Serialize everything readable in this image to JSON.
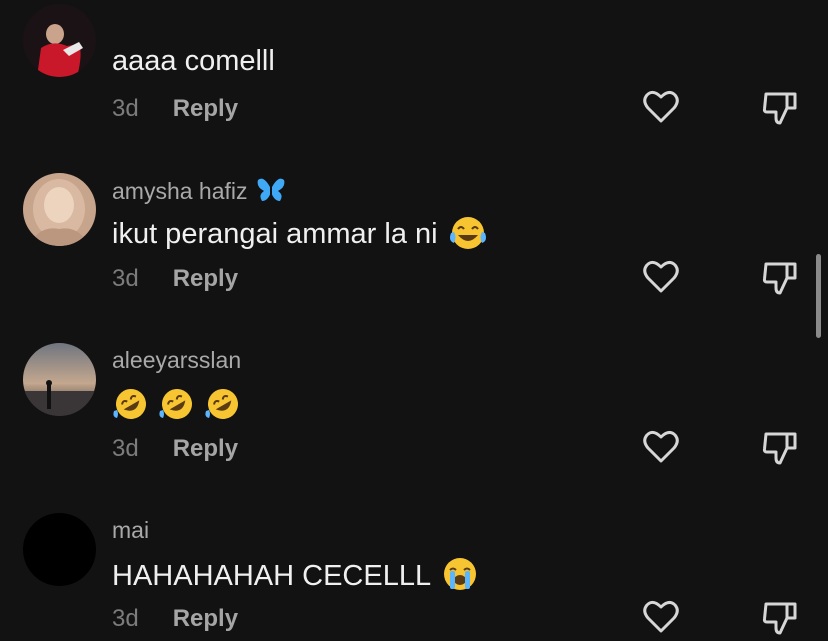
{
  "comments": [
    {
      "username": "",
      "text": "aaaa comelll",
      "emojis": [],
      "time": "3d",
      "reply": "Reply"
    },
    {
      "username": "amysha hafiz",
      "badge_icon": "butterfly-icon",
      "text": "ikut perangai ammar la ni",
      "emojis": [
        "laughing-tears-emoji"
      ],
      "time": "3d",
      "reply": "Reply"
    },
    {
      "username": "aleeyarsslan",
      "text": "",
      "emojis": [
        "rofl-emoji",
        "rofl-emoji",
        "rofl-emoji"
      ],
      "time": "3d",
      "reply": "Reply"
    },
    {
      "username": "mai",
      "text": "HAHAHAHAH CECELLL",
      "emojis": [
        "crying-face-emoji"
      ],
      "time": "3d",
      "reply": "Reply"
    }
  ],
  "icons": {
    "like": "heart-outline-icon",
    "dislike": "thumbs-down-icon"
  },
  "colors": {
    "background": "#121212",
    "badge": "#3fa9f5",
    "emoji": "#f7c531"
  }
}
